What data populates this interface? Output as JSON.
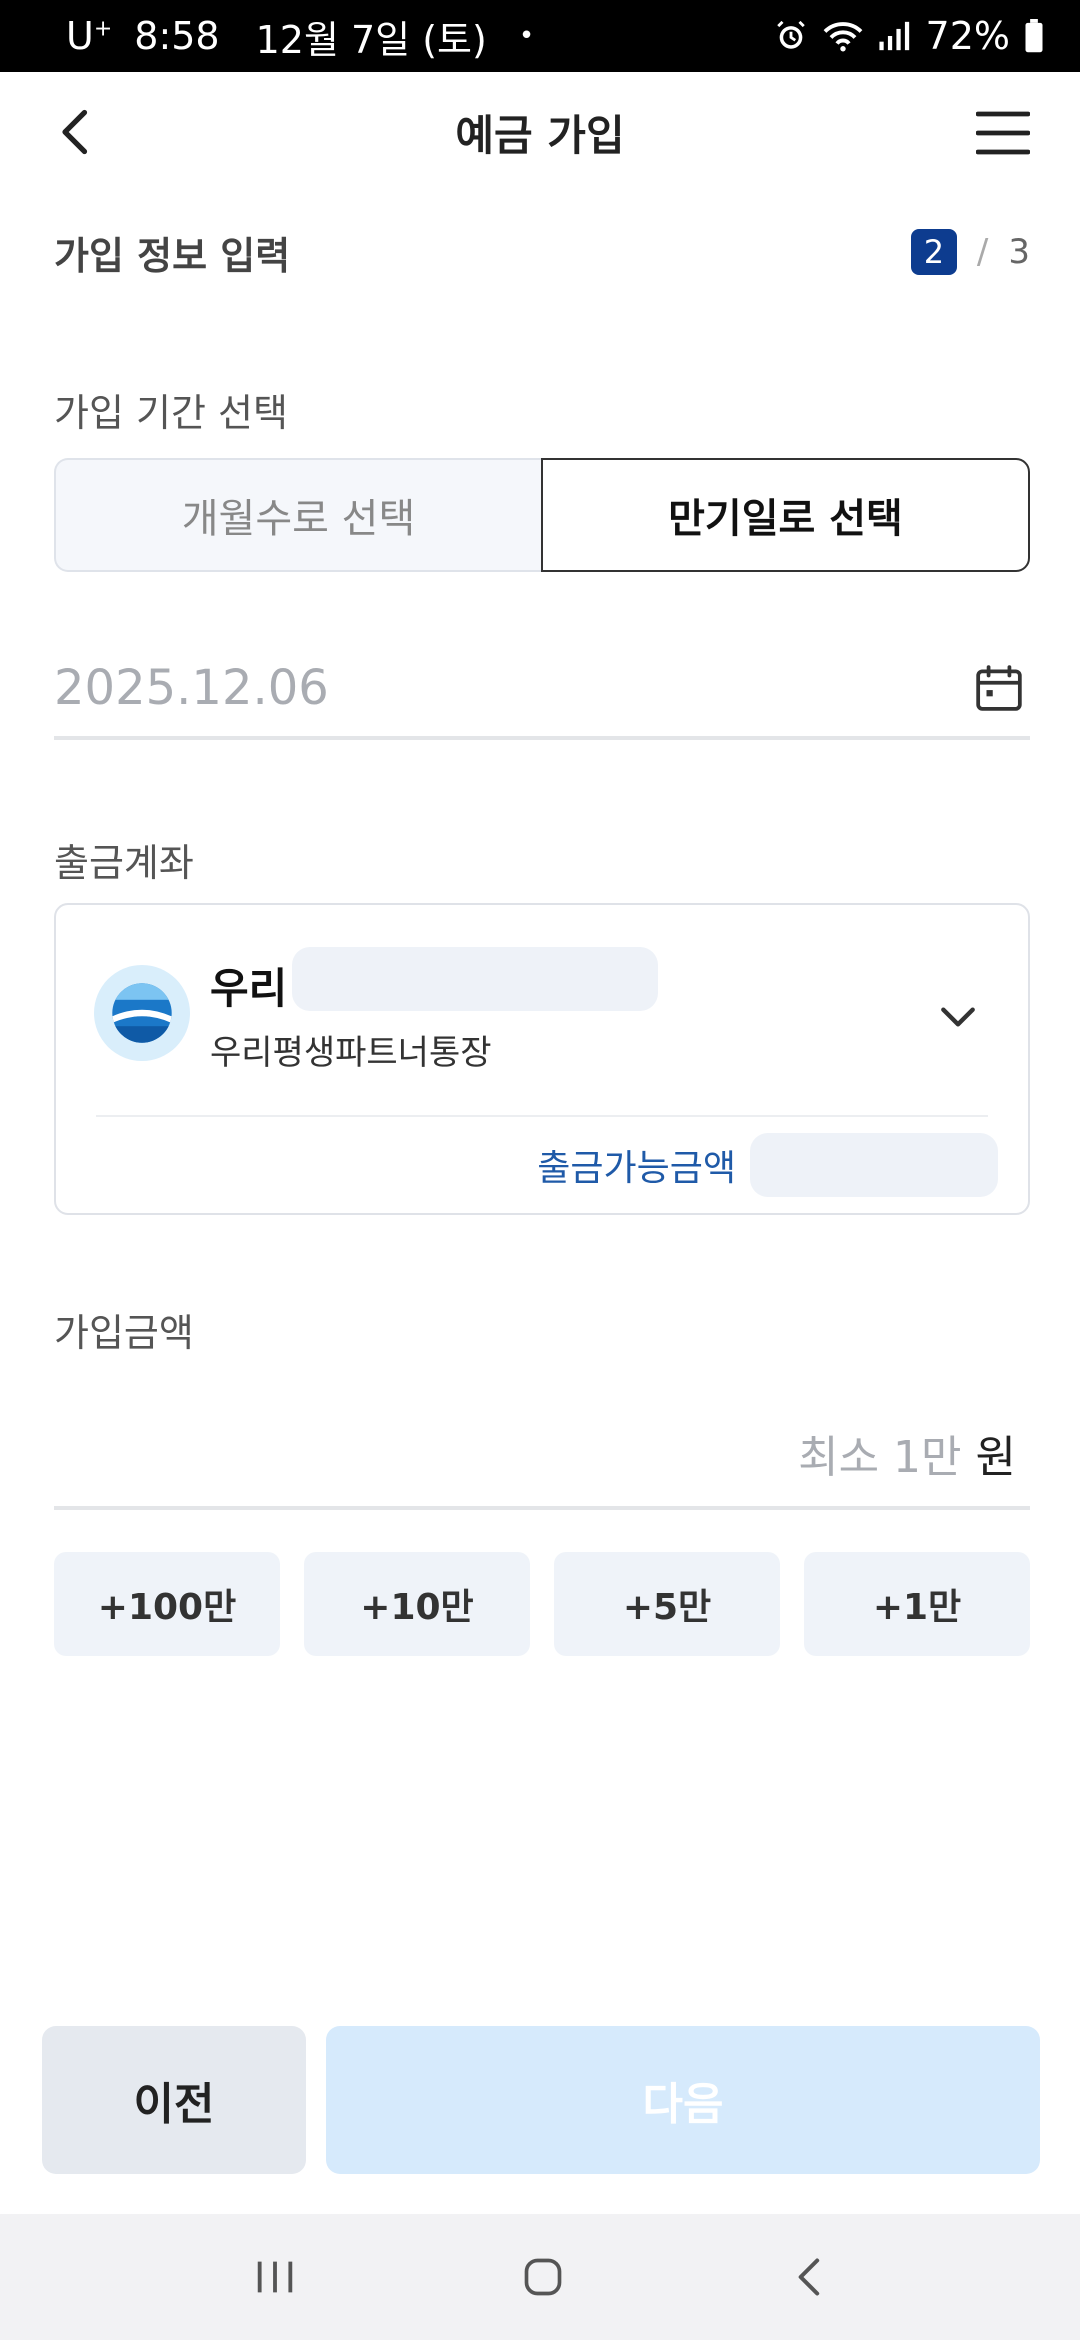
{
  "status_bar": {
    "carrier": "U",
    "carrier_sup": "+",
    "time": "8:58",
    "date": "12월 7일 (토)",
    "dot": "•",
    "battery": "72%"
  },
  "header": {
    "title": "예금 가입"
  },
  "step": {
    "title": "가입 정보 입력",
    "current": "2",
    "separator": "/",
    "total": "3"
  },
  "period": {
    "label": "가입 기간 선택",
    "option_months": "개월수로 선택",
    "option_maturity": "만기일로 선택",
    "selected": "만기일로 선택"
  },
  "maturity_date": {
    "value": "2025.12.06"
  },
  "withdrawal": {
    "label": "출금계좌",
    "bank_name": "우리",
    "product_name": "우리평생파트너통장",
    "available_label": "출금가능금액"
  },
  "amount": {
    "label": "가입금액",
    "placeholder": "최소 1만",
    "unit": "원",
    "quick_buttons": [
      "+100만",
      "+10만",
      "+5만",
      "+1만"
    ]
  },
  "footer": {
    "prev_label": "이전",
    "next_label": "다음"
  },
  "colors": {
    "accent": "#0d3c8f",
    "link": "#1f5aa8",
    "next_disabled_bg": "#d6eafc"
  }
}
